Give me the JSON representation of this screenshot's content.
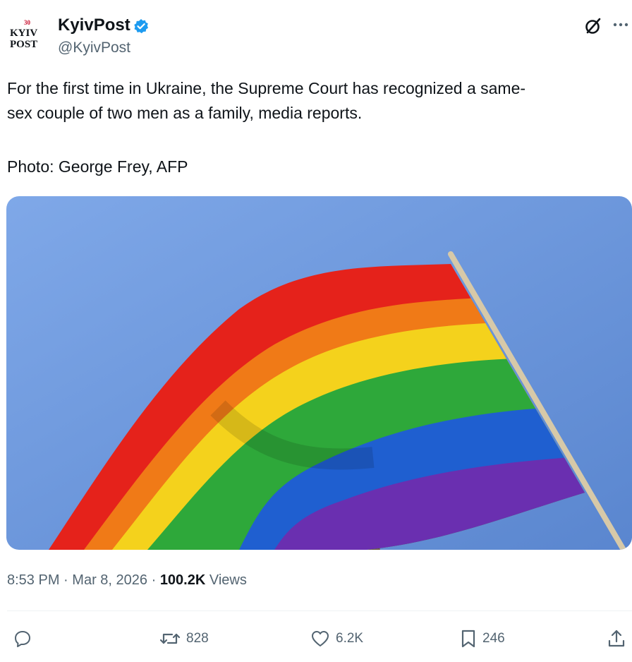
{
  "author": {
    "logo_lines": [
      "KYIV",
      "POST"
    ],
    "logo_badge": "30",
    "display_name": "KyivPost",
    "handle": "@KyivPost",
    "verified_color": "#1d9bf0",
    "logo_icon": "kyivpost-logo-icon"
  },
  "header_icons": [
    "grok-icon",
    "more-icon"
  ],
  "tweet": {
    "text_line1": "For the first time in Ukraine, the Supreme Court has recognized a same-",
    "text_line2": "sex couple of two men as a family, media reports.",
    "photo_credit": "Photo: George Frey, AFP"
  },
  "media": {
    "description_icon": "rainbow-flag-image",
    "colors": [
      "#e5221b",
      "#f07a17",
      "#f4d21c",
      "#2ea83a",
      "#1f5fd0",
      "#6a2fb0"
    ]
  },
  "meta": {
    "time": "8:53 PM",
    "separator": "·",
    "date": "Mar 8, 2026",
    "views_count": "100.2K",
    "views_label": "Views"
  },
  "actions": {
    "reply_count": "",
    "retweet_count": "828",
    "like_count": "6.2K",
    "bookmark_count": "246"
  }
}
